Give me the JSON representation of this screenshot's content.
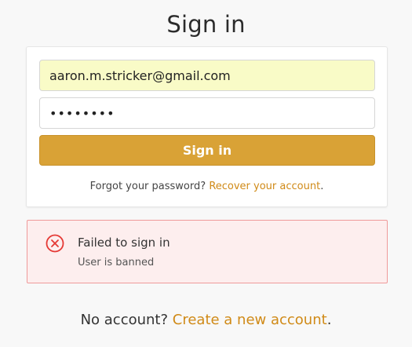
{
  "title": "Sign in",
  "form": {
    "email_value": "aaron.m.stricker@gmail.com",
    "password_value": "••••••••",
    "submit_label": "Sign in",
    "forgot_text": "Forgot your password?",
    "recover_link": "Recover your account",
    "recover_suffix": "."
  },
  "alert": {
    "icon": "error-circle-x-icon",
    "title": "Failed to sign in",
    "message": "User is banned",
    "color": "#e53935"
  },
  "footer": {
    "text": "No account?",
    "link": "Create a new account",
    "suffix": "."
  },
  "colors": {
    "accent": "#d9a236",
    "link": "#d08a17",
    "error_bg": "#fdeeee",
    "error_border": "#ef9a9a"
  }
}
